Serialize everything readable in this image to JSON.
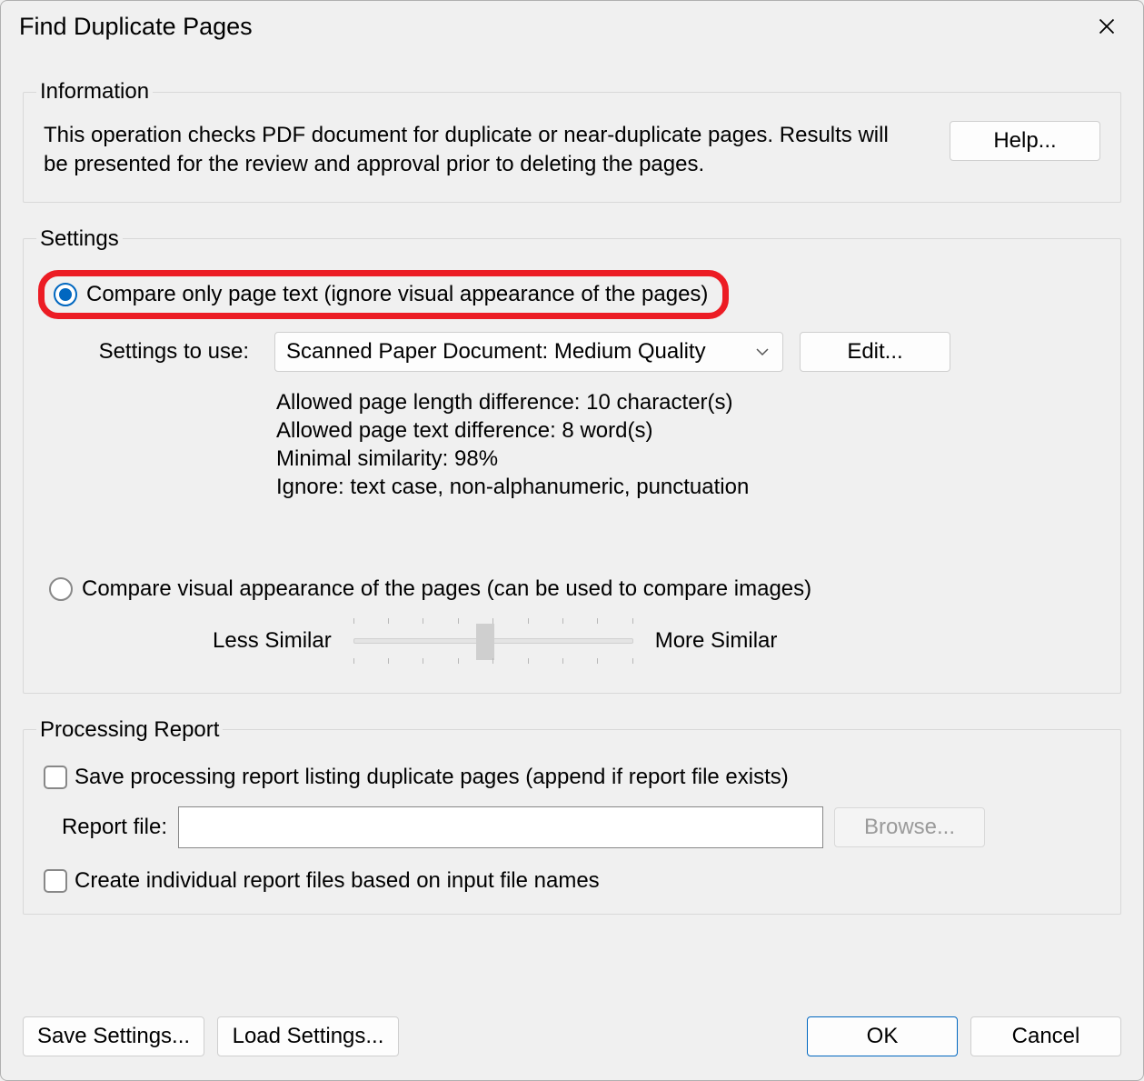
{
  "title": "Find Duplicate Pages",
  "information": {
    "legend": "Information",
    "text": "This operation checks PDF document for duplicate or near-duplicate pages. Results will be presented for the review and approval prior to deleting the pages.",
    "help_label": "Help..."
  },
  "settings": {
    "legend": "Settings",
    "radio_text_label": "Compare only page text (ignore visual appearance of the pages)",
    "settings_to_use_label": "Settings to use:",
    "combo_value": "Scanned Paper Document: Medium Quality",
    "edit_label": "Edit...",
    "details_line1": "Allowed page length difference: 10 character(s)",
    "details_line2": "Allowed page text difference: 8 word(s)",
    "details_line3": "Minimal similarity: 98%",
    "details_line4": "Ignore: text case, non-alphanumeric, punctuation",
    "radio_visual_label": "Compare visual appearance of the pages (can be used to compare images)",
    "less_similar_label": "Less Similar",
    "more_similar_label": "More Similar"
  },
  "report": {
    "legend": "Processing Report",
    "save_report_label": "Save processing report listing duplicate pages (append if report file exists)",
    "report_file_label": "Report file:",
    "report_file_value": "",
    "browse_label": "Browse...",
    "individual_reports_label": "Create individual report files based on input file names"
  },
  "footer": {
    "save_settings_label": "Save Settings...",
    "load_settings_label": "Load Settings...",
    "ok_label": "OK",
    "cancel_label": "Cancel"
  }
}
